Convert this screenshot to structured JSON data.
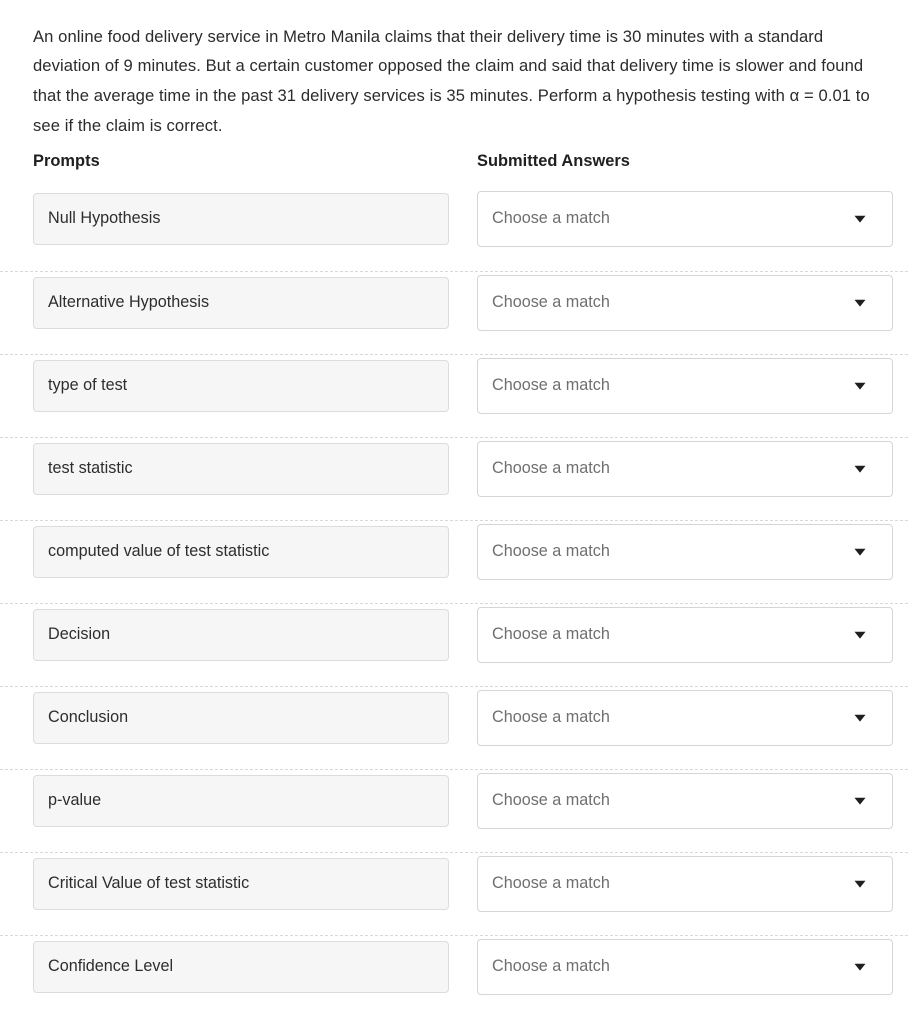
{
  "question": {
    "text": "An online food delivery service in Metro Manila claims that their delivery time is 30 minutes with a standard deviation of 9 minutes. But a certain customer opposed the claim and said that delivery time is slower and found that the average time in the past 31 delivery services is 35 minutes. Perform a hypothesis testing with α = 0.01 to see if the claim is correct."
  },
  "headers": {
    "prompts": "Prompts",
    "answers": "Submitted Answers"
  },
  "placeholder": "Choose a match",
  "colors": {
    "prompt_fill": "#f6f6f6",
    "prompt_border": "#dcdcdc",
    "select_border": "#d6d6d6",
    "divider": "#d8d8da",
    "body_text": "#2b2b2b",
    "placeholder_text": "#6f6f6f",
    "caret": "#1f1f1f"
  },
  "rows": [
    {
      "prompt": "Null Hypothesis",
      "answer": "Choose a match",
      "caret_icon": "chevron-down-icon"
    },
    {
      "prompt": "Alternative Hypothesis",
      "answer": "Choose a match",
      "caret_icon": "chevron-down-icon"
    },
    {
      "prompt": "type of test",
      "answer": "Choose a match",
      "caret_icon": "chevron-down-icon"
    },
    {
      "prompt": "test statistic",
      "answer": "Choose a match",
      "caret_icon": "chevron-down-icon"
    },
    {
      "prompt": "computed value of test statistic",
      "answer": "Choose a match",
      "caret_icon": "chevron-down-icon"
    },
    {
      "prompt": "Decision",
      "answer": "Choose a match",
      "caret_icon": "chevron-down-icon"
    },
    {
      "prompt": "Conclusion",
      "answer": "Choose a match",
      "caret_icon": "chevron-down-icon"
    },
    {
      "prompt": "p-value",
      "answer": "Choose a match",
      "caret_icon": "chevron-down-icon"
    },
    {
      "prompt": "Critical Value of test statistic",
      "answer": "Choose a match",
      "caret_icon": "chevron-down-icon"
    },
    {
      "prompt": "Confidence Level",
      "answer": "Choose a match",
      "caret_icon": "chevron-down-icon"
    }
  ]
}
